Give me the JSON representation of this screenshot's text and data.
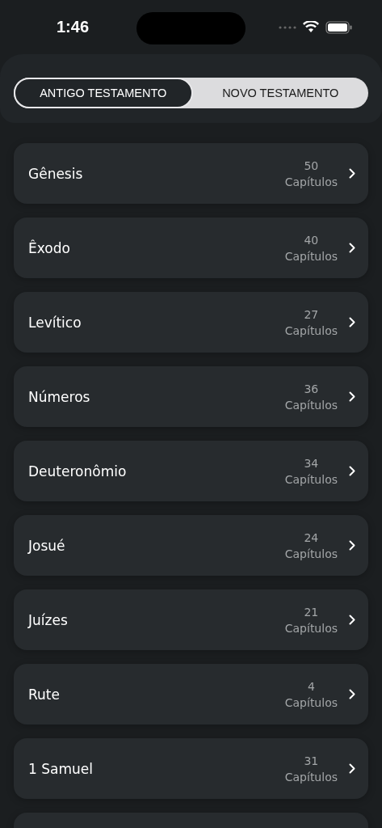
{
  "status_bar": {
    "time": "1:46"
  },
  "tabs": [
    {
      "label": "ANTIGO TESTAMENTO",
      "selected": true
    },
    {
      "label": "NOVO TESTAMENTO",
      "selected": false
    }
  ],
  "books": [
    {
      "name": "Gênesis",
      "count": "50",
      "unit": "Capítulos"
    },
    {
      "name": "Êxodo",
      "count": "40",
      "unit": "Capítulos"
    },
    {
      "name": "Levítico",
      "count": "27",
      "unit": "Capítulos"
    },
    {
      "name": "Números",
      "count": "36",
      "unit": "Capítulos"
    },
    {
      "name": "Deuteronômio",
      "count": "34",
      "unit": "Capítulos"
    },
    {
      "name": "Josué",
      "count": "24",
      "unit": "Capítulos"
    },
    {
      "name": "Juízes",
      "count": "21",
      "unit": "Capítulos"
    },
    {
      "name": "Rute",
      "count": "4",
      "unit": "Capítulos"
    },
    {
      "name": "1 Samuel",
      "count": "31",
      "unit": "Capítulos"
    }
  ]
}
